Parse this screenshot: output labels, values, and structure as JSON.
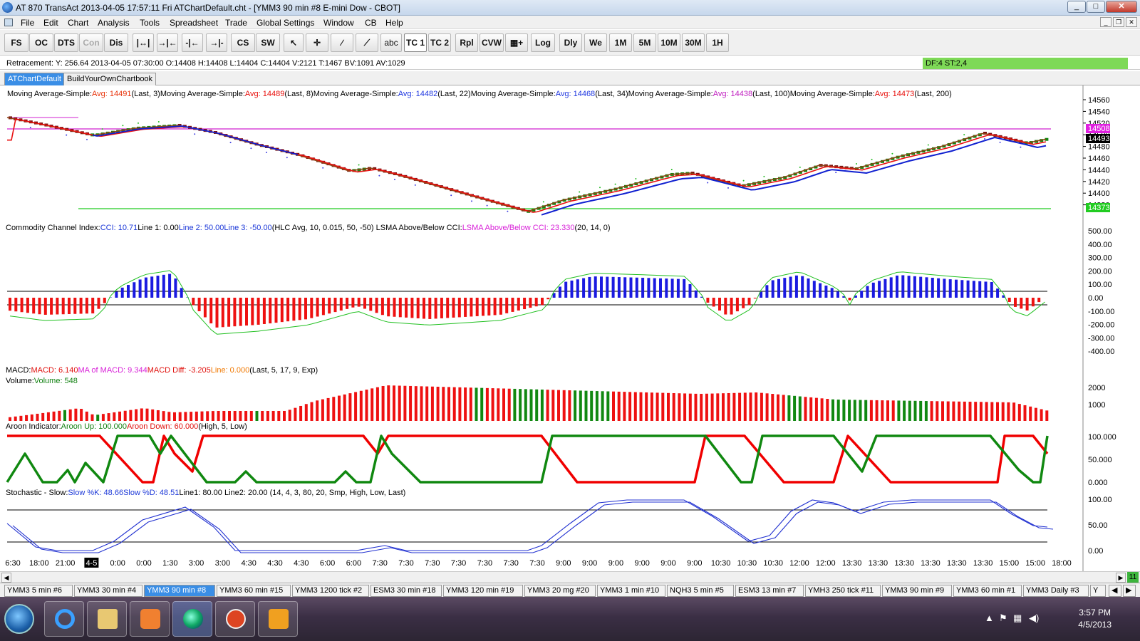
{
  "window": {
    "title": "AT 870 TransAct 2013-04-05  17:57:11 Fri  ATChartDefault.cht - [YMM3  90 min  #8  E-mini Dow - CBOT]"
  },
  "menu": [
    "File",
    "Edit",
    "Chart",
    "Analysis",
    "Tools",
    "Spreadsheet",
    "Trade",
    "Global Settings",
    "Window",
    "CB",
    "Help"
  ],
  "toolbar": {
    "fs": "FS",
    "oc": "OC",
    "dts": "DTS",
    "con": "Con",
    "dis": "Dis",
    "cs": "CS",
    "sw": "SW",
    "abc": "abc",
    "tc1": "TC 1",
    "tc2": "TC 2",
    "rpl": "Rpl",
    "cvw": "CVW",
    "log": "Log",
    "dly": "Dly",
    "we": "We",
    "m1": "1M",
    "m5": "5M",
    "m10": "10M",
    "m30": "30M",
    "h1": "1H"
  },
  "infobar": {
    "retracement": "Retracement: Y: 256.64  2013-04-05  07:30:00  O:14408  H:14408  L:14404  C:14404  V:2121  T:1467  BV:1091  AV:1029",
    "df": "DF:4  ST:2,4"
  },
  "chart_tabs": [
    "ATChartDefault",
    "BuildYourOwnChartbook"
  ],
  "price_panel": {
    "legend": [
      {
        "t": "Moving Average-Simple: ",
        "c": "#000"
      },
      {
        "t": "Avg: 14491 ",
        "c": "#e8340c"
      },
      {
        "t": " (Last, 3) ",
        "c": "#000"
      },
      {
        "t": "Moving Average-Simple: ",
        "c": "#000"
      },
      {
        "t": "Avg: 14489 ",
        "c": "#e8100c"
      },
      {
        "t": " (Last, 8) ",
        "c": "#000"
      },
      {
        "t": "Moving Average-Simple: ",
        "c": "#000"
      },
      {
        "t": "Avg: 14482 ",
        "c": "#2038e0"
      },
      {
        "t": " (Last, 22) ",
        "c": "#000"
      },
      {
        "t": "Moving Average-Simple: ",
        "c": "#000"
      },
      {
        "t": "Avg: 14468 ",
        "c": "#2038e0"
      },
      {
        "t": " (Last, 34) ",
        "c": "#000"
      },
      {
        "t": "Moving Average-Simple: ",
        "c": "#000"
      },
      {
        "t": "Avg: 14438 ",
        "c": "#c020c0"
      },
      {
        "t": " (Last, 100) ",
        "c": "#000"
      },
      {
        "t": "Moving Average-Simple: ",
        "c": "#000"
      },
      {
        "t": "Avg: 14473 ",
        "c": "#e8100c"
      },
      {
        "t": " (Last, 200)",
        "c": "#000"
      }
    ],
    "axis_labels": [
      "14560",
      "14540",
      "14520",
      "14500",
      "14480",
      "14460",
      "14440",
      "14420",
      "14400",
      "14380"
    ],
    "markers": {
      "magenta": "14508",
      "black": "14493",
      "green": "14373"
    }
  },
  "cci_panel": {
    "legend": [
      {
        "t": "Commodity Channel Index: ",
        "c": "#000"
      },
      {
        "t": "CCI: 10.71 ",
        "c": "#1c38d8"
      },
      {
        "t": " Line 1: 0.00 ",
        "c": "#000"
      },
      {
        "t": " Line 2: 50.00 ",
        "c": "#1c38d8"
      },
      {
        "t": " Line 3: -50.00 ",
        "c": "#1c38d8"
      },
      {
        "t": "  (HLC Avg, 10, 0.015, 50, -50)  LSMA Above/Below CCI: ",
        "c": "#000"
      },
      {
        "t": "LSMA Above/Below CCI: 23.330",
        "c": "#d820d8"
      },
      {
        "t": "  (20, 14, 0)",
        "c": "#000"
      }
    ],
    "axis_labels": [
      "500.00",
      "400.00",
      "300.00",
      "200.00",
      "100.00",
      "0.00",
      "-100.00",
      "-200.00",
      "-300.00",
      "-400.00"
    ]
  },
  "macd_panel": {
    "legend": [
      {
        "t": "MACD: ",
        "c": "#000"
      },
      {
        "t": "MACD: 6.140 ",
        "c": "#e0100c"
      },
      {
        "t": " MA of MACD: 9.344 ",
        "c": "#d820d8"
      },
      {
        "t": " MACD Diff: -3.205 ",
        "c": "#e0100c"
      },
      {
        "t": " Line: 0.000 ",
        "c": "#f07800"
      },
      {
        "t": "  (Last, 5, 17, 9, Exp)",
        "c": "#000"
      }
    ],
    "vol_legend": [
      {
        "t": "Volume: ",
        "c": "#000"
      },
      {
        "t": "Volume: 548",
        "c": "#108010"
      }
    ],
    "axis_labels": [
      "2000",
      "1000"
    ]
  },
  "aroon_panel": {
    "legend": [
      {
        "t": "Aroon Indicator: ",
        "c": "#000"
      },
      {
        "t": "Aroon Up: 100.000 ",
        "c": "#108010"
      },
      {
        "t": " Aroon Down: 60.000 ",
        "c": "#e0100c"
      },
      {
        "t": "  (High, 5, Low)",
        "c": "#000"
      }
    ],
    "axis_labels": [
      "100.000",
      "50.000",
      "0.000"
    ]
  },
  "stoch_panel": {
    "legend": [
      {
        "t": "Stochastic - Slow: ",
        "c": "#000"
      },
      {
        "t": "Slow %K: 48.66 ",
        "c": "#1c38d8"
      },
      {
        "t": " Slow %D: 48.51 ",
        "c": "#1c38d8"
      },
      {
        "t": " Line1: 80.00  Line2: 20.00   (14, 4, 3, 80, 20, Smp, High, Low, Last)",
        "c": "#000"
      }
    ],
    "axis_labels": [
      "100.00",
      "50.00",
      "0.00"
    ]
  },
  "time_axis": [
    "6:30",
    "18:00",
    "21:00",
    "4-5",
    "0:00",
    "0:00",
    "1:30",
    "3:00",
    "3:00",
    "4:30",
    "4:30",
    "4:30",
    "6:00",
    "6:00",
    "7:30",
    "7:30",
    "7:30",
    "7:30",
    "7:30",
    "7:30",
    "7:30",
    "9:00",
    "9:00",
    "9:00",
    "9:00",
    "9:00",
    "9:00",
    "10:30",
    "10:30",
    "10:30",
    "12:00",
    "12:00",
    "13:30",
    "13:30",
    "13:30",
    "13:30",
    "13:30",
    "13:30",
    "15:00",
    "15:00",
    "18:00"
  ],
  "scroll_number": "11",
  "workspace_tabs": [
    "YMM3  5 min   #6",
    "YMM3  30 min   #4",
    "YMM3  90 min   #8",
    "YMM3  60 min   #15",
    "YMM3  1200 tick   #2",
    "ESM3  30 min   #18",
    "YMM3  120 min   #19",
    "YMM3  20 mg   #20",
    "YMM3  1 min   #10",
    "NQH3  5 min   #5",
    "ESM3  13 min   #7",
    "YMH3  250 tick   #11",
    "YMM3  90 min   #9",
    "YMM3  60 min   #1",
    "YMM3  Daily   #3",
    "Y"
  ],
  "taskbar": {
    "time": "3:57 PM",
    "date": "4/5/2013"
  },
  "colors": {
    "up": "#118811",
    "down": "#ee1111",
    "cci_up": "#1a1ae0",
    "ma_brown": "#8b4513",
    "ma_red": "#e81010",
    "ma_blue": "#1020d0"
  }
}
